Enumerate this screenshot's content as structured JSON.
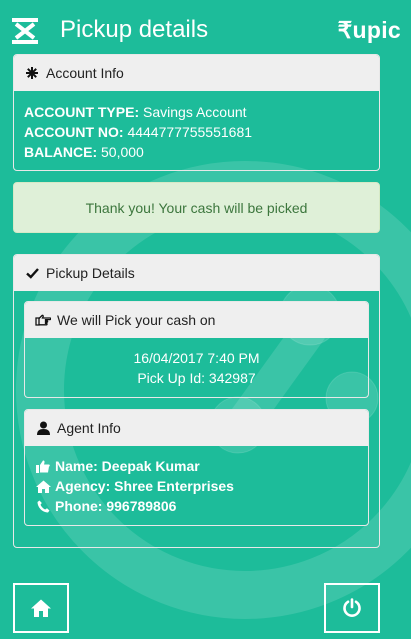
{
  "header": {
    "title": "Pickup details",
    "brand": "₹upic",
    "menu_icon": "currency-menu-icon"
  },
  "account": {
    "heading": "Account Info",
    "heading_icon": "asterisk-icon",
    "type_label": "ACCOUNT TYPE:",
    "type_value": "Savings Account",
    "number_label": "ACCOUNT NO:",
    "number_value": "4444777755551681",
    "balance_label": "BALANCE:",
    "balance_value": "50,000"
  },
  "alert": {
    "message": "Thank you! Your cash will be picked"
  },
  "pickup": {
    "heading": "Pickup Details",
    "heading_icon": "checkmark-icon",
    "schedule": {
      "heading": "We will Pick your cash on",
      "heading_icon": "hand-pointing-icon",
      "datetime": "16/04/2017 7:40 PM",
      "pickup_id": "Pick Up Id: 342987"
    },
    "agent": {
      "heading": "Agent Info",
      "heading_icon": "user-icon",
      "name": "Name: Deepak Kumar",
      "agency": "Agency: Shree Enterprises",
      "phone": "Phone: 996789806"
    }
  },
  "footer": {
    "home_icon": "home-icon",
    "power_icon": "power-icon"
  },
  "colors": {
    "background": "#1dbc9a",
    "panel_header": "#efefef",
    "alert_bg": "#dff0d8",
    "alert_text": "#3c763d"
  }
}
